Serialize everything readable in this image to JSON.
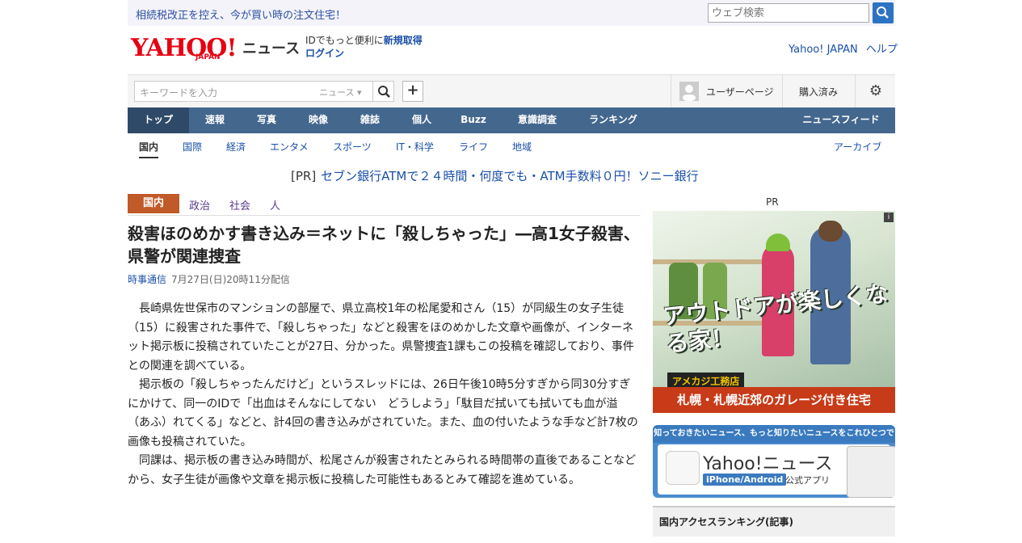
{
  "topbar": {
    "promo": "相続税改正を控え、今が買い時の注文住宅！",
    "search_placeholder": "ウェブ検索"
  },
  "header": {
    "logo_text": "YAHOO!",
    "logo_sub": "JAPAN",
    "news_word": "ニュース",
    "id_prefix": "IDでもっと便利に",
    "register": "新規取得",
    "login": "ログイン",
    "link_yahoo": "Yahoo! JAPAN",
    "link_help": "ヘルプ"
  },
  "search": {
    "placeholder": "キーワードを入力",
    "category": "ニュース",
    "user_page": "ユーザーページ",
    "purchased": "購入済み"
  },
  "nav": {
    "items": [
      "トップ",
      "速報",
      "写真",
      "映像",
      "雑誌",
      "個人",
      "Buzz",
      "意識調査",
      "ランキング"
    ],
    "feed": "ニュースフィード"
  },
  "subnav": {
    "items": [
      "国内",
      "国際",
      "経済",
      "エンタメ",
      "スポーツ",
      "IT・科学",
      "ライフ",
      "地域"
    ],
    "archive": "アーカイブ"
  },
  "pr": {
    "tag": "[PR]",
    "text": "セブン銀行ATMで２４時間・何度でも・ATM手数料０円！ソニー銀行"
  },
  "article": {
    "category_badge": "国内",
    "category_links": [
      "政治",
      "社会",
      "人"
    ],
    "title": "殺害ほのめかす書き込み＝ネットに「殺しちゃった」―高1女子殺害、県警が関連捜査",
    "source": "時事通信",
    "date": "7月27日(日)20時11分配信",
    "paragraphs": [
      "長崎県佐世保市のマンションの部屋で、県立高校1年の松尾愛和さん（15）が同級生の女子生徒（15）に殺害された事件で、「殺しちゃった」などと殺害をほのめかした文章や画像が、インターネット掲示板に投稿されていたことが27日、分かった。県警捜査1課もこの投稿を確認しており、事件との関連を調べている。",
      "掲示板の「殺しちゃったんだけど」というスレッドには、26日午後10時5分すぎから同30分すぎにかけて、同一のIDで「出血はそんなにしてない　どうしよう」「駄目だ拭いても拭いても血が溢（あふ）れてくる」などと、計4回の書き込みがされていた。また、血の付いたような手など計7枚の画像も投稿されていた。",
      "同課は、掲示板の書き込み時間が、松尾さんが殺害されたとみられる時間帯の直後であることなどから、女子生徒が画像や文章を掲示板に投稿した可能性もあるとみて確認を進めている。"
    ]
  },
  "sidebar": {
    "pr_label": "PR",
    "ad": {
      "copy": "アウトドアが楽しくなる家！",
      "brand": "アメカジ工務店",
      "strip": "札幌・札幌近郊のガレージ付き住宅",
      "info": "i"
    },
    "app": {
      "top": "知っておきたいニュース、もっと知りたいニュースをこれひとつで",
      "name": "Yahoo!ニュース",
      "platform": "iPhone/Android",
      "official": "公式アプリ"
    },
    "ranking_title": "国内アクセスランキング(記事)"
  },
  "colors": {
    "nav_bg": "#44678e",
    "badge": "#c05a28",
    "link": "#1a4fa8",
    "logo": "#e60012"
  }
}
